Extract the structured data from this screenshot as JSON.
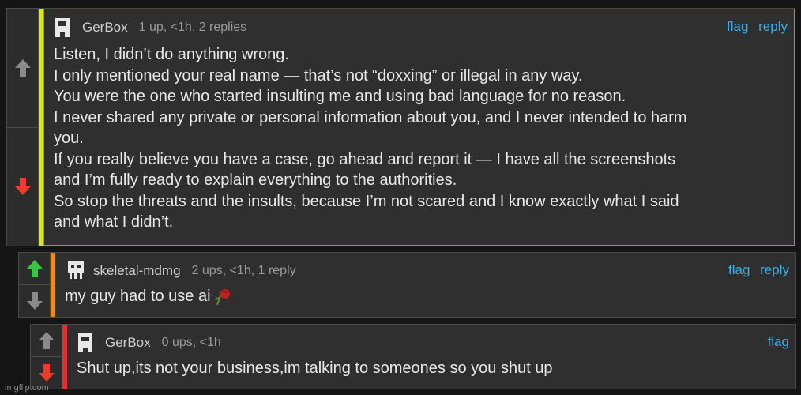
{
  "comments": [
    {
      "username": "GerBox",
      "meta": "1 up, <1h, 2 replies",
      "actions": [
        "flag",
        "reply"
      ],
      "lines": [
        "Listen, I didn’t do anything wrong.",
        "I only mentioned your real name — that’s not “doxxing” or illegal in any way.",
        "You were the one who started insulting me and using bad language for no reason.",
        "I never shared any private or personal information about you, and I never intended to harm",
        "you.",
        "If you really believe you have a case, go ahead and report it — I have all the screenshots",
        "and I’m fully ready to explain everything to the authorities.",
        "So stop the threats and the insults, because I’m not scared and I know exactly what I said",
        "and what I didn’t."
      ],
      "upvote_state": "inactive",
      "downvote_state": "active",
      "bar_color": "#d8e61a"
    },
    {
      "username": "skeletal-mdmg",
      "meta": "2 ups, <1h, 1 reply",
      "actions": [
        "flag",
        "reply"
      ],
      "lines": [
        "my guy had to use ai"
      ],
      "upvote_state": "active",
      "downvote_state": "inactive",
      "bar_color": "#f08a12"
    },
    {
      "username": "GerBox",
      "meta": "0 ups, <1h",
      "actions": [
        "flag"
      ],
      "lines": [
        "Shut up,its not your business,im talking to someones so you shut up"
      ],
      "upvote_state": "inactive",
      "downvote_state": "active",
      "bar_color": "#e03030"
    }
  ],
  "colors": {
    "upvote_active": "#3cc43c",
    "downvote_active": "#f03a2a",
    "vote_inactive": "#8a8a8a",
    "link": "#3aaee6"
  },
  "watermark": "imgflip.com"
}
